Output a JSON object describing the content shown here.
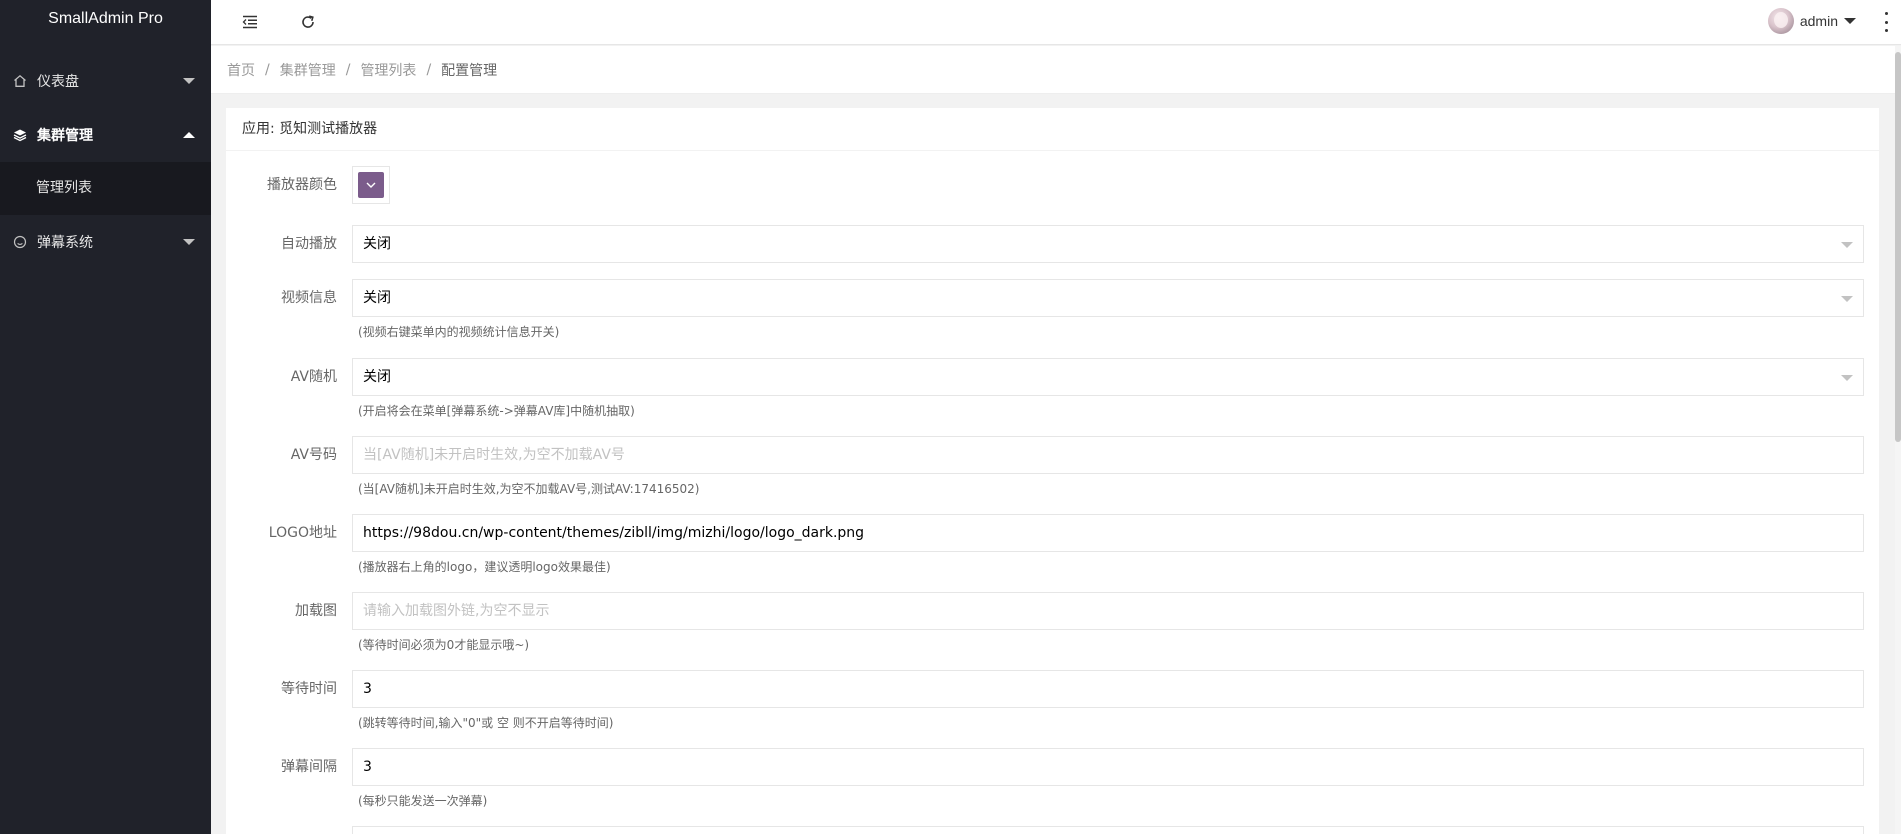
{
  "app": {
    "title": "SmallAdmin Pro"
  },
  "sidebar": {
    "items": [
      {
        "label": "仪表盘",
        "icon": "home-icon"
      },
      {
        "label": "集群管理",
        "icon": "layers-icon",
        "expanded": true,
        "children": [
          {
            "label": "管理列表"
          }
        ]
      },
      {
        "label": "弹幕系统",
        "icon": "smile-icon"
      }
    ]
  },
  "header": {
    "user": "admin",
    "icons": [
      "menu-fold-icon",
      "refresh-icon",
      "more-vertical-icon"
    ]
  },
  "breadcrumb": [
    "首页",
    "集群管理",
    "管理列表",
    "配置管理"
  ],
  "card": {
    "title": "应用: 觅知测试播放器"
  },
  "form": {
    "player_color": {
      "label": "播放器颜色",
      "value_color": "#7b5c8b"
    },
    "autoplay": {
      "label": "自动播放",
      "value": "关闭"
    },
    "video_info": {
      "label": "视频信息",
      "value": "关闭",
      "help": "(视频右键菜单内的视频统计信息开关)"
    },
    "av_random": {
      "label": "AV随机",
      "value": "关闭",
      "help": "(开启将会在菜单[弹幕系统->弹幕AV库]中随机抽取)"
    },
    "av_number": {
      "label": "AV号码",
      "placeholder": "当[AV随机]未开启时生效,为空不加载AV号",
      "help": "(当[AV随机]未开启时生效,为空不加载AV号,测试AV:17416502)"
    },
    "logo_url": {
      "label": "LOGO地址",
      "value": "https://98dou.cn/wp-content/themes/zibll/img/mizhi/logo/logo_dark.png",
      "help": "(播放器右上角的logo，建议透明logo效果最佳)"
    },
    "loading_image": {
      "label": "加载图",
      "placeholder": "请输入加载图外链,为空不显示",
      "help": "(等待时间必须为0才能显示哦~)"
    },
    "wait_time": {
      "label": "等待时间",
      "value": "3",
      "help": "(跳转等待时间,输入\"0\"或 空 则不开启等待时间)"
    },
    "danmaku_interval": {
      "label": "弹幕间隔",
      "value": "3",
      "help": "(每秒只能发送一次弹幕)"
    }
  },
  "colors": {
    "sidebar_bg": "#20222a",
    "submenu_bg": "#18191f",
    "page_bg": "#f2f2f2",
    "swatch": "#7b5c8b"
  }
}
